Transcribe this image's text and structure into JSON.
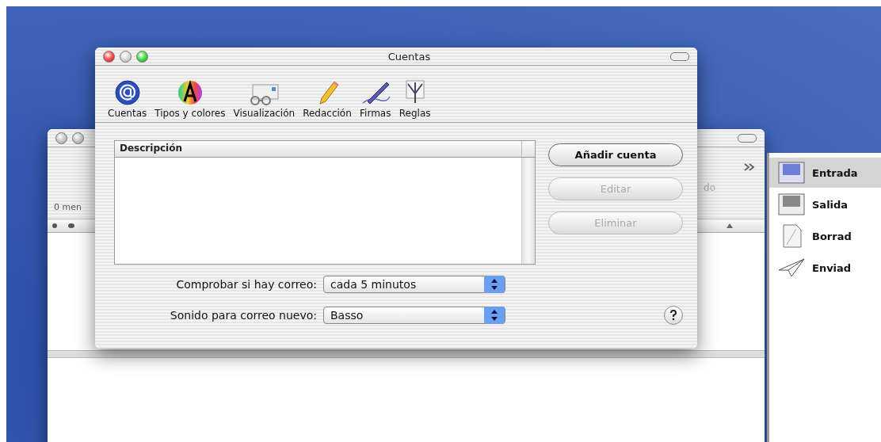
{
  "back_window": {
    "status": "0 men",
    "partial_label": "do"
  },
  "drawer": {
    "mailboxes": [
      {
        "label": "Entrada",
        "kind": "inbox",
        "selected": true
      },
      {
        "label": "Salida",
        "kind": "outbox",
        "selected": false
      },
      {
        "label": "Borrad",
        "kind": "drafts",
        "selected": false
      },
      {
        "label": "Enviad",
        "kind": "sent",
        "selected": false
      }
    ]
  },
  "front_window": {
    "title": "Cuentas",
    "toolbar": [
      {
        "label": "Cuentas",
        "kind": "at"
      },
      {
        "label": "Tipos y colores",
        "kind": "colors"
      },
      {
        "label": "Visualización",
        "kind": "glasses"
      },
      {
        "label": "Redacción",
        "kind": "pencil"
      },
      {
        "label": "Firmas",
        "kind": "pen"
      },
      {
        "label": "Reglas",
        "kind": "rules"
      }
    ],
    "table": {
      "columns": [
        "Descripción"
      ]
    },
    "buttons": [
      {
        "label": "Añadir cuenta",
        "disabled": false
      },
      {
        "label": "Editar",
        "disabled": true
      },
      {
        "label": "Eliminar",
        "disabled": true
      }
    ],
    "settings": [
      {
        "label": "Comprobar si hay correo:",
        "value": "cada 5 minutos"
      },
      {
        "label": "Sonido para correo nuevo:",
        "value": "Basso"
      }
    ]
  }
}
